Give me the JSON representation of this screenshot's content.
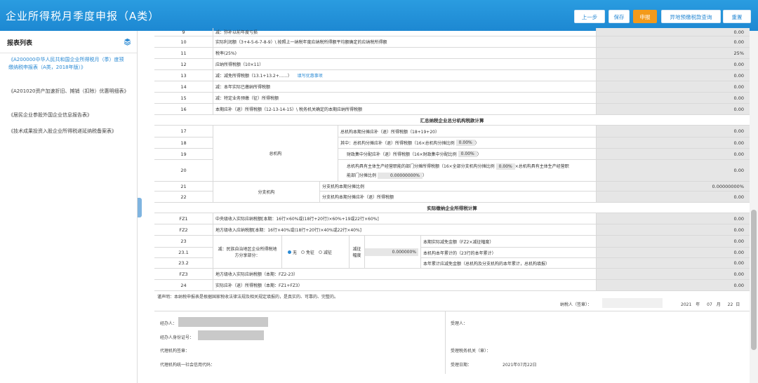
{
  "header": {
    "title": "企业所得税月季度申报（A类）",
    "buttons": {
      "prev": "上一步",
      "save": "保存",
      "declare": "申报",
      "remote": "异地预缴税款查询",
      "reset": "重置"
    }
  },
  "sidebar": {
    "title": "报表列表",
    "items": [
      "《A200000中华人民共和国企业所得税月（季）度预缴纳税申报表（A类，2018年版）》",
      "《A201020资产加速折旧、摊销（扣除）优惠明细表》",
      "《居民企业参股外国企业信息报告表》",
      "《技术成果投资入股企业所得税递延纳税备案表》"
    ]
  },
  "table": {
    "row9": {
      "no": "9",
      "desc": "减：弥补以前年度亏损",
      "val": "0.00"
    },
    "rows_a": [
      {
        "no": "10",
        "desc": "实际利润额（3+4-5-6-7-8-9）\\ 按照上一纳税年度应纳税所得额平均额确定的应纳税所得额",
        "val": "0.00"
      },
      {
        "no": "11",
        "desc": "税率(25%)",
        "val": "25%"
      },
      {
        "no": "12",
        "desc": "应纳所得税额（10×11）",
        "val": "0.00"
      },
      {
        "no": "13",
        "desc": "减：减免所得税额（13.1+13.2+……）",
        "val": "0.00",
        "link": "填写优惠事项"
      },
      {
        "no": "14",
        "desc": "减：本年实际已缴纳所得税额",
        "val": "0.00"
      },
      {
        "no": "15",
        "desc": "减：特定业务预缴（征）所得税额",
        "val": "0.00"
      },
      {
        "no": "16",
        "desc": "本期应补（退）所得税额（12-13-14-15）\\ 税务机关确定的本期应纳所得税额",
        "val": "0.00"
      }
    ],
    "sec_summary": "汇总纳税企业总分机构税款计算",
    "zongjigou": {
      "label": "总机构",
      "r17": {
        "no": "17",
        "desc": "总机构本期分摊应补（退）所得税额（18+19+20）",
        "val": "0.00"
      },
      "r18": {
        "no": "18",
        "desc": "其中：总机构分摊应补（退）所得税额（16×总机构分摊比例",
        "ratio": "0.00%",
        "tail": "）",
        "val": "0.00"
      },
      "r19": {
        "no": "19",
        "desc": "财政集中分配应补（退）所得税额（16×财政集中分配比例",
        "ratio": "0.00%",
        "tail": "）",
        "val": "0.00"
      },
      "r20": {
        "no": "20",
        "desc1": "总机构具有主体生产经营职能的部门分摊所得税额（16×全部分支机构分摊比例",
        "ratio1": "0.00%",
        "mid": "×总机构具有主体生产经营职",
        "desc2": "能部门分摊比例",
        "ratio2": "0.00000000%",
        "tail": "）",
        "val": "0.00"
      }
    },
    "fenzhi": {
      "label": "分支机构",
      "r21": {
        "no": "21",
        "desc": "分支机构本期分摊比例",
        "val": "0.00000000%"
      },
      "r22": {
        "no": "22",
        "desc": "分支机构本期分摊应补（退）所得税额",
        "val": "0.00"
      }
    },
    "sec_actual": "实际缴纳企业所得税计算",
    "fz1": {
      "no": "FZ1",
      "desc": "中央级收入实际应纳税额[本期：16行×60%或(18行+20行)×60%+19或22行×60%]",
      "val": "0.00"
    },
    "fz2": {
      "no": "FZ2",
      "desc": "地方级收入应纳税额[本期：16行×40%或(18行+20行)×40%或22行×40%]",
      "val": "0.00"
    },
    "r23": {
      "no": "23",
      "no1": "23.1",
      "no2": "23.2",
      "label": "减：民族自治地区企业所得税地方分享部分：",
      "opts": [
        "无",
        "免征",
        "减征"
      ],
      "jz_label": "减征幅度",
      "jz_val": "0.000000%",
      "d23": "本期实际减免金额（FZ2×减征幅度）",
      "d231": "本机构本年累计的（23行的本年累计）",
      "d232": "本年累计应减免金额（总机构及分支机构的本年累计，总机构填报）",
      "v23": "0.00",
      "v231": "0.00",
      "v232": "0.00"
    },
    "fz3": {
      "no": "FZ3",
      "desc": "地方级收入实际应纳税额（本期：FZ2-23）",
      "val": "0.00"
    },
    "r24": {
      "no": "24",
      "desc": "实际应补（退）所得税额（本期：FZ1+FZ3）",
      "val": "0.00"
    }
  },
  "declaration": "谨声明：本纳税申报表是根据国家税收法律法规及相关规定填报的，是真实的、可靠的、完整的。",
  "signature": {
    "label": "纳税人（签章）：",
    "year": "2021",
    "year_unit": "年",
    "month": "07",
    "month_unit": "月",
    "day": "22",
    "day_unit": "日"
  },
  "footer": {
    "agent": "经办人：",
    "agent_id": "经办人身份证号：",
    "agency_seal": "代理机构签章：",
    "agency_code": "代理机构统一社会信用代码：",
    "receiver": "受理人：",
    "tax_office": "受理税务机关（章）：",
    "accept_date_label": "受理日期：",
    "accept_date": "2021年07月22日"
  }
}
